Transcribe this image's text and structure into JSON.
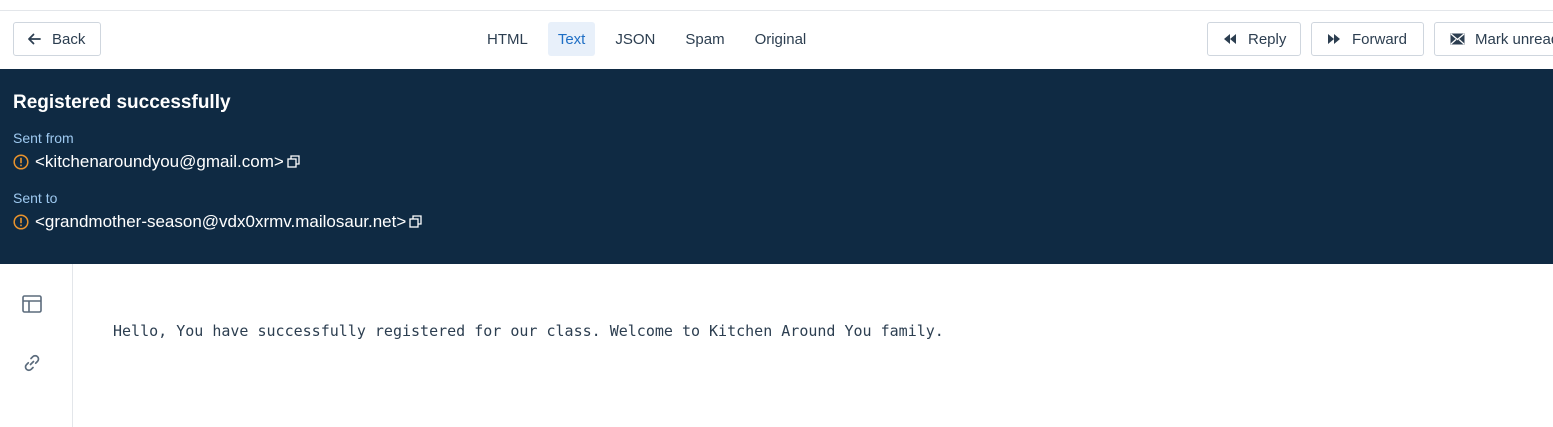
{
  "toolbar": {
    "back_label": "Back",
    "tabs": [
      {
        "label": "HTML",
        "active": false
      },
      {
        "label": "Text",
        "active": true
      },
      {
        "label": "JSON",
        "active": false
      },
      {
        "label": "Spam",
        "active": false
      },
      {
        "label": "Original",
        "active": false
      }
    ],
    "reply_label": "Reply",
    "forward_label": "Forward",
    "mark_unread_label": "Mark unread"
  },
  "header": {
    "subject": "Registered successfully",
    "from_label": "Sent from",
    "from_address": "<kitchenaroundyou@gmail.com>",
    "to_label": "Sent to",
    "to_address": "<grandmother-season@vdx0xrmv.mailosaur.net>"
  },
  "sidebar": {
    "icons": [
      "layout-icon",
      "link-icon"
    ]
  },
  "body": {
    "text": "Hello, You have successfully registered for our class. Welcome to Kitchen Around You family."
  },
  "colors": {
    "header_bg": "#0f2a43",
    "label_blue": "#9ec9f0",
    "warning_orange": "#e8932d",
    "active_tab_bg": "#e8f0fa",
    "active_tab_text": "#1f6fc5"
  }
}
